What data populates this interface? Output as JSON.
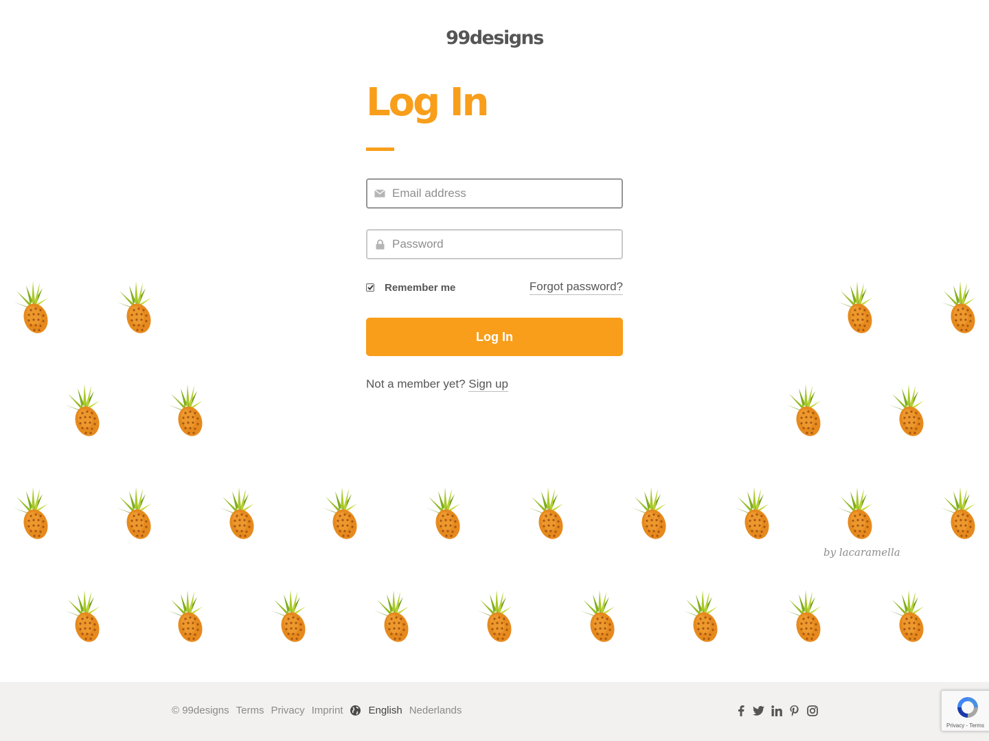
{
  "brand": {
    "logo_text": "99designs",
    "accent_color": "#f89e1a"
  },
  "login": {
    "title": "Log In",
    "email_placeholder": "Email address",
    "password_placeholder": "Password",
    "remember_label": "Remember me",
    "remember_checked": true,
    "forgot_label": "Forgot password?",
    "submit_label": "Log In",
    "signup_prompt": "Not a member yet?",
    "signup_label": "Sign up"
  },
  "background": {
    "credit": "by lacaramella",
    "pattern_icon": "pineapple-icon"
  },
  "footer": {
    "copyright": "© 99designs",
    "links": [
      "Terms",
      "Privacy",
      "Imprint"
    ],
    "languages": [
      "English",
      "Nederlands"
    ],
    "active_language": "English",
    "social_icons": [
      "facebook-icon",
      "twitter-icon",
      "linkedin-icon",
      "pinterest-icon",
      "instagram-icon"
    ]
  },
  "recaptcha": {
    "text": "Privacy - Terms"
  }
}
